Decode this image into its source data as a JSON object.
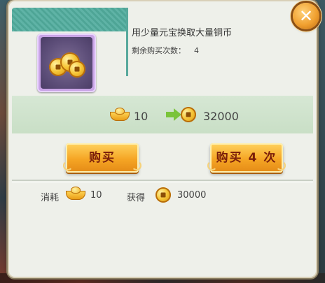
{
  "dialog": {
    "title": "用少量元宝换取大量铜币",
    "remaining_label": "剩余购买次数：",
    "remaining_count": "4",
    "item_icon": "copper-coins-icon"
  },
  "exchange": {
    "cost_icon": "gold-ingot-icon",
    "cost_amount": "10",
    "arrow_icon": "arrow-right-icon",
    "reward_icon": "copper-coin-icon",
    "reward_amount": "32000"
  },
  "buttons": {
    "buy_label": "购买",
    "buy_multiple_label": "购买 4 次",
    "close_icon": "close-icon"
  },
  "summary": {
    "cost_label": "消耗",
    "cost_amount": "10",
    "gain_label": "获得",
    "gain_amount": "30000"
  },
  "colors": {
    "button": "#f5a524",
    "button_text": "#7a1e0a",
    "exchange_band": "#d6e7d4",
    "item_slot": "#c9a4e6"
  }
}
